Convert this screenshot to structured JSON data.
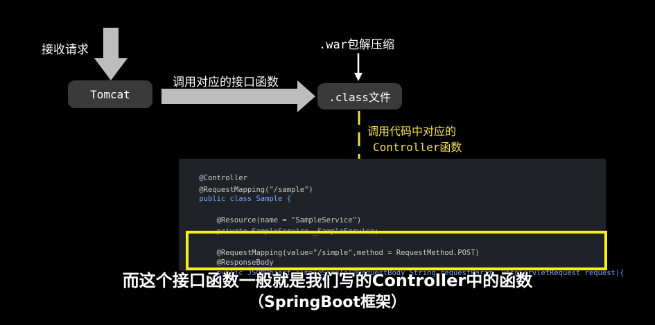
{
  "diagram": {
    "receive_request_label": "接收请求",
    "tomcat_label": "Tomcat",
    "call_interface_label": "调用对应的接口函数",
    "war_unpack_label": ".war包解压缩",
    "class_file_label": ".class文件",
    "call_controller_line1": "调用代码中对应的",
    "call_controller_line2": "Controller函数"
  },
  "code": {
    "lines": [
      [
        "@Controller"
      ],
      [
        "@RequestMapping(\"/sample\")"
      ],
      [
        "public class Sample {"
      ],
      [
        ""
      ],
      [
        "    @Resource(name = \"SampleService\")"
      ],
      [
        "    private SampleService _SampleService;"
      ],
      [
        ""
      ],
      [
        "    @RequestMapping(value=\"/simple\",method = RequestMethod.POST)"
      ],
      [
        "    @ResponseBody"
      ],
      [
        "    public JSONObject simpleSample(@RequestBody String requestParam, HttpServletRequest request){"
      ]
    ]
  },
  "subtitles": {
    "line1": "而这个接口函数一般就是我们写的Controller中的函数",
    "line2": "（SpringBoot框架）"
  },
  "colors": {
    "background": "#000000",
    "node_box": "#3a3a3a",
    "arrow_gray": "#bdbdbd",
    "annotation_yellow": "#f5e04a",
    "highlight_yellow": "#f6ef1b",
    "code_background": "#1f2328"
  }
}
